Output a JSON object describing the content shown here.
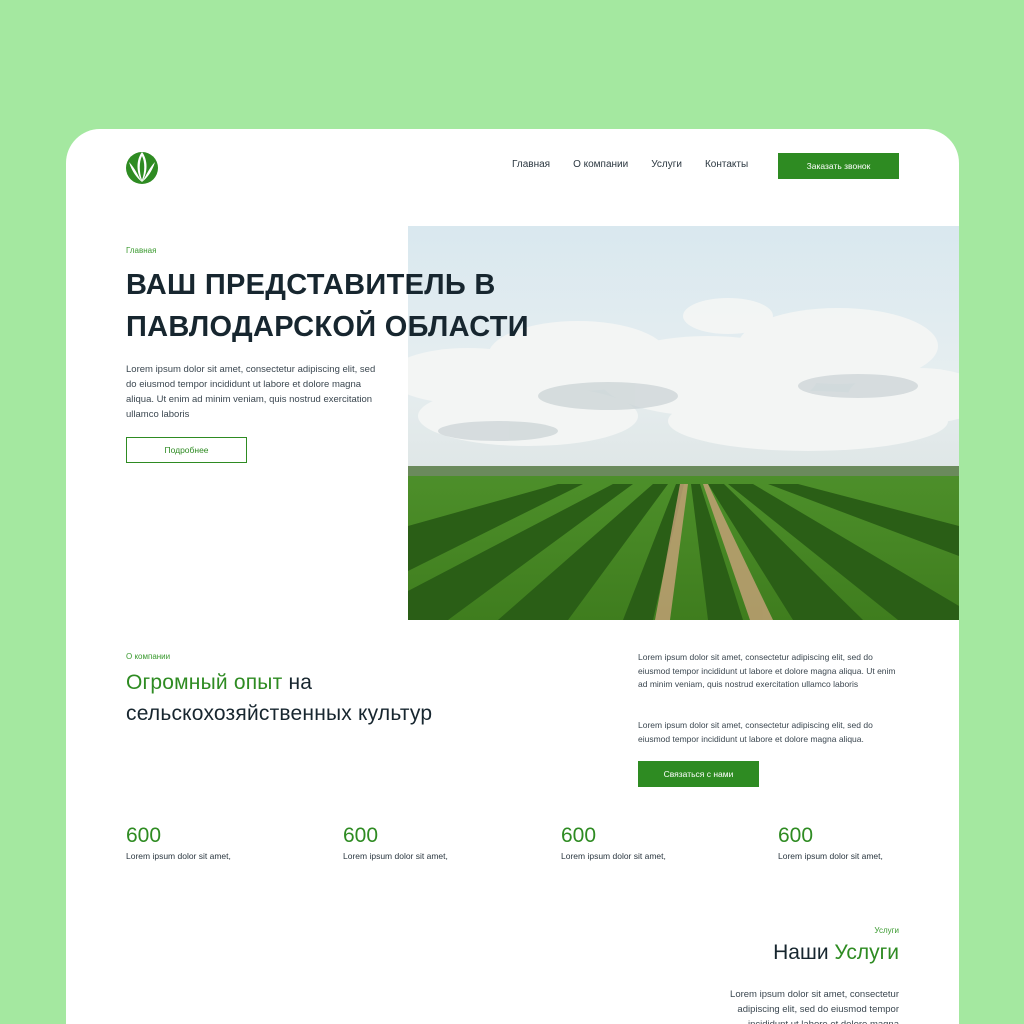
{
  "header": {
    "nav": [
      "Главная",
      "О компании",
      "Услуги",
      "Контакты"
    ],
    "cta_label": "Заказать звонок"
  },
  "hero": {
    "breadcrumb": "Главная",
    "title_line1": "ВАШ ПРЕДСТАВИТЕЛЬ В",
    "title_line2": "ПАВЛОДАРСКОЙ ОБЛАСТИ",
    "text": "Lorem ipsum dolor sit amet, consectetur adipiscing elit, sed do eiusmod tempor incididunt ut labore et dolore magna aliqua. Ut enim ad minim veniam, quis nostrud exercitation ullamco laboris",
    "button_label": "Подробнее"
  },
  "about": {
    "label": "О компании",
    "title_green": "Огромный опыт",
    "title_rest1": " на",
    "title_line2": "сельскохозяйственных культур",
    "paragraph1": "Lorem ipsum dolor sit amet, consectetur adipiscing elit, sed do eiusmod tempor incididunt ut labore et dolore magna aliqua. Ut enim ad minim veniam, quis nostrud exercitation ullamco laboris",
    "paragraph2": "Lorem ipsum dolor sit amet, consectetur adipiscing elit, sed do eiusmod tempor incididunt ut labore et dolore magna aliqua.",
    "button_label": "Связаться с нами"
  },
  "stats": [
    {
      "value": "600",
      "label": "Lorem ipsum dolor sit amet,"
    },
    {
      "value": "600",
      "label": "Lorem ipsum dolor sit amet,"
    },
    {
      "value": "600",
      "label": "Lorem ipsum dolor sit amet,"
    },
    {
      "value": "600",
      "label": "Lorem ipsum dolor sit amet,"
    }
  ],
  "services": {
    "label": "Услуги",
    "title_dark": "Наши ",
    "title_green": "Услуги",
    "text": "Lorem ipsum dolor sit amet, consectetur adipiscing elit, sed do eiusmod tempor incididunt ut labore et dolore magna"
  },
  "colors": {
    "background": "#a4e8a0",
    "accent": "#2e8b22",
    "heading": "#17262f"
  }
}
